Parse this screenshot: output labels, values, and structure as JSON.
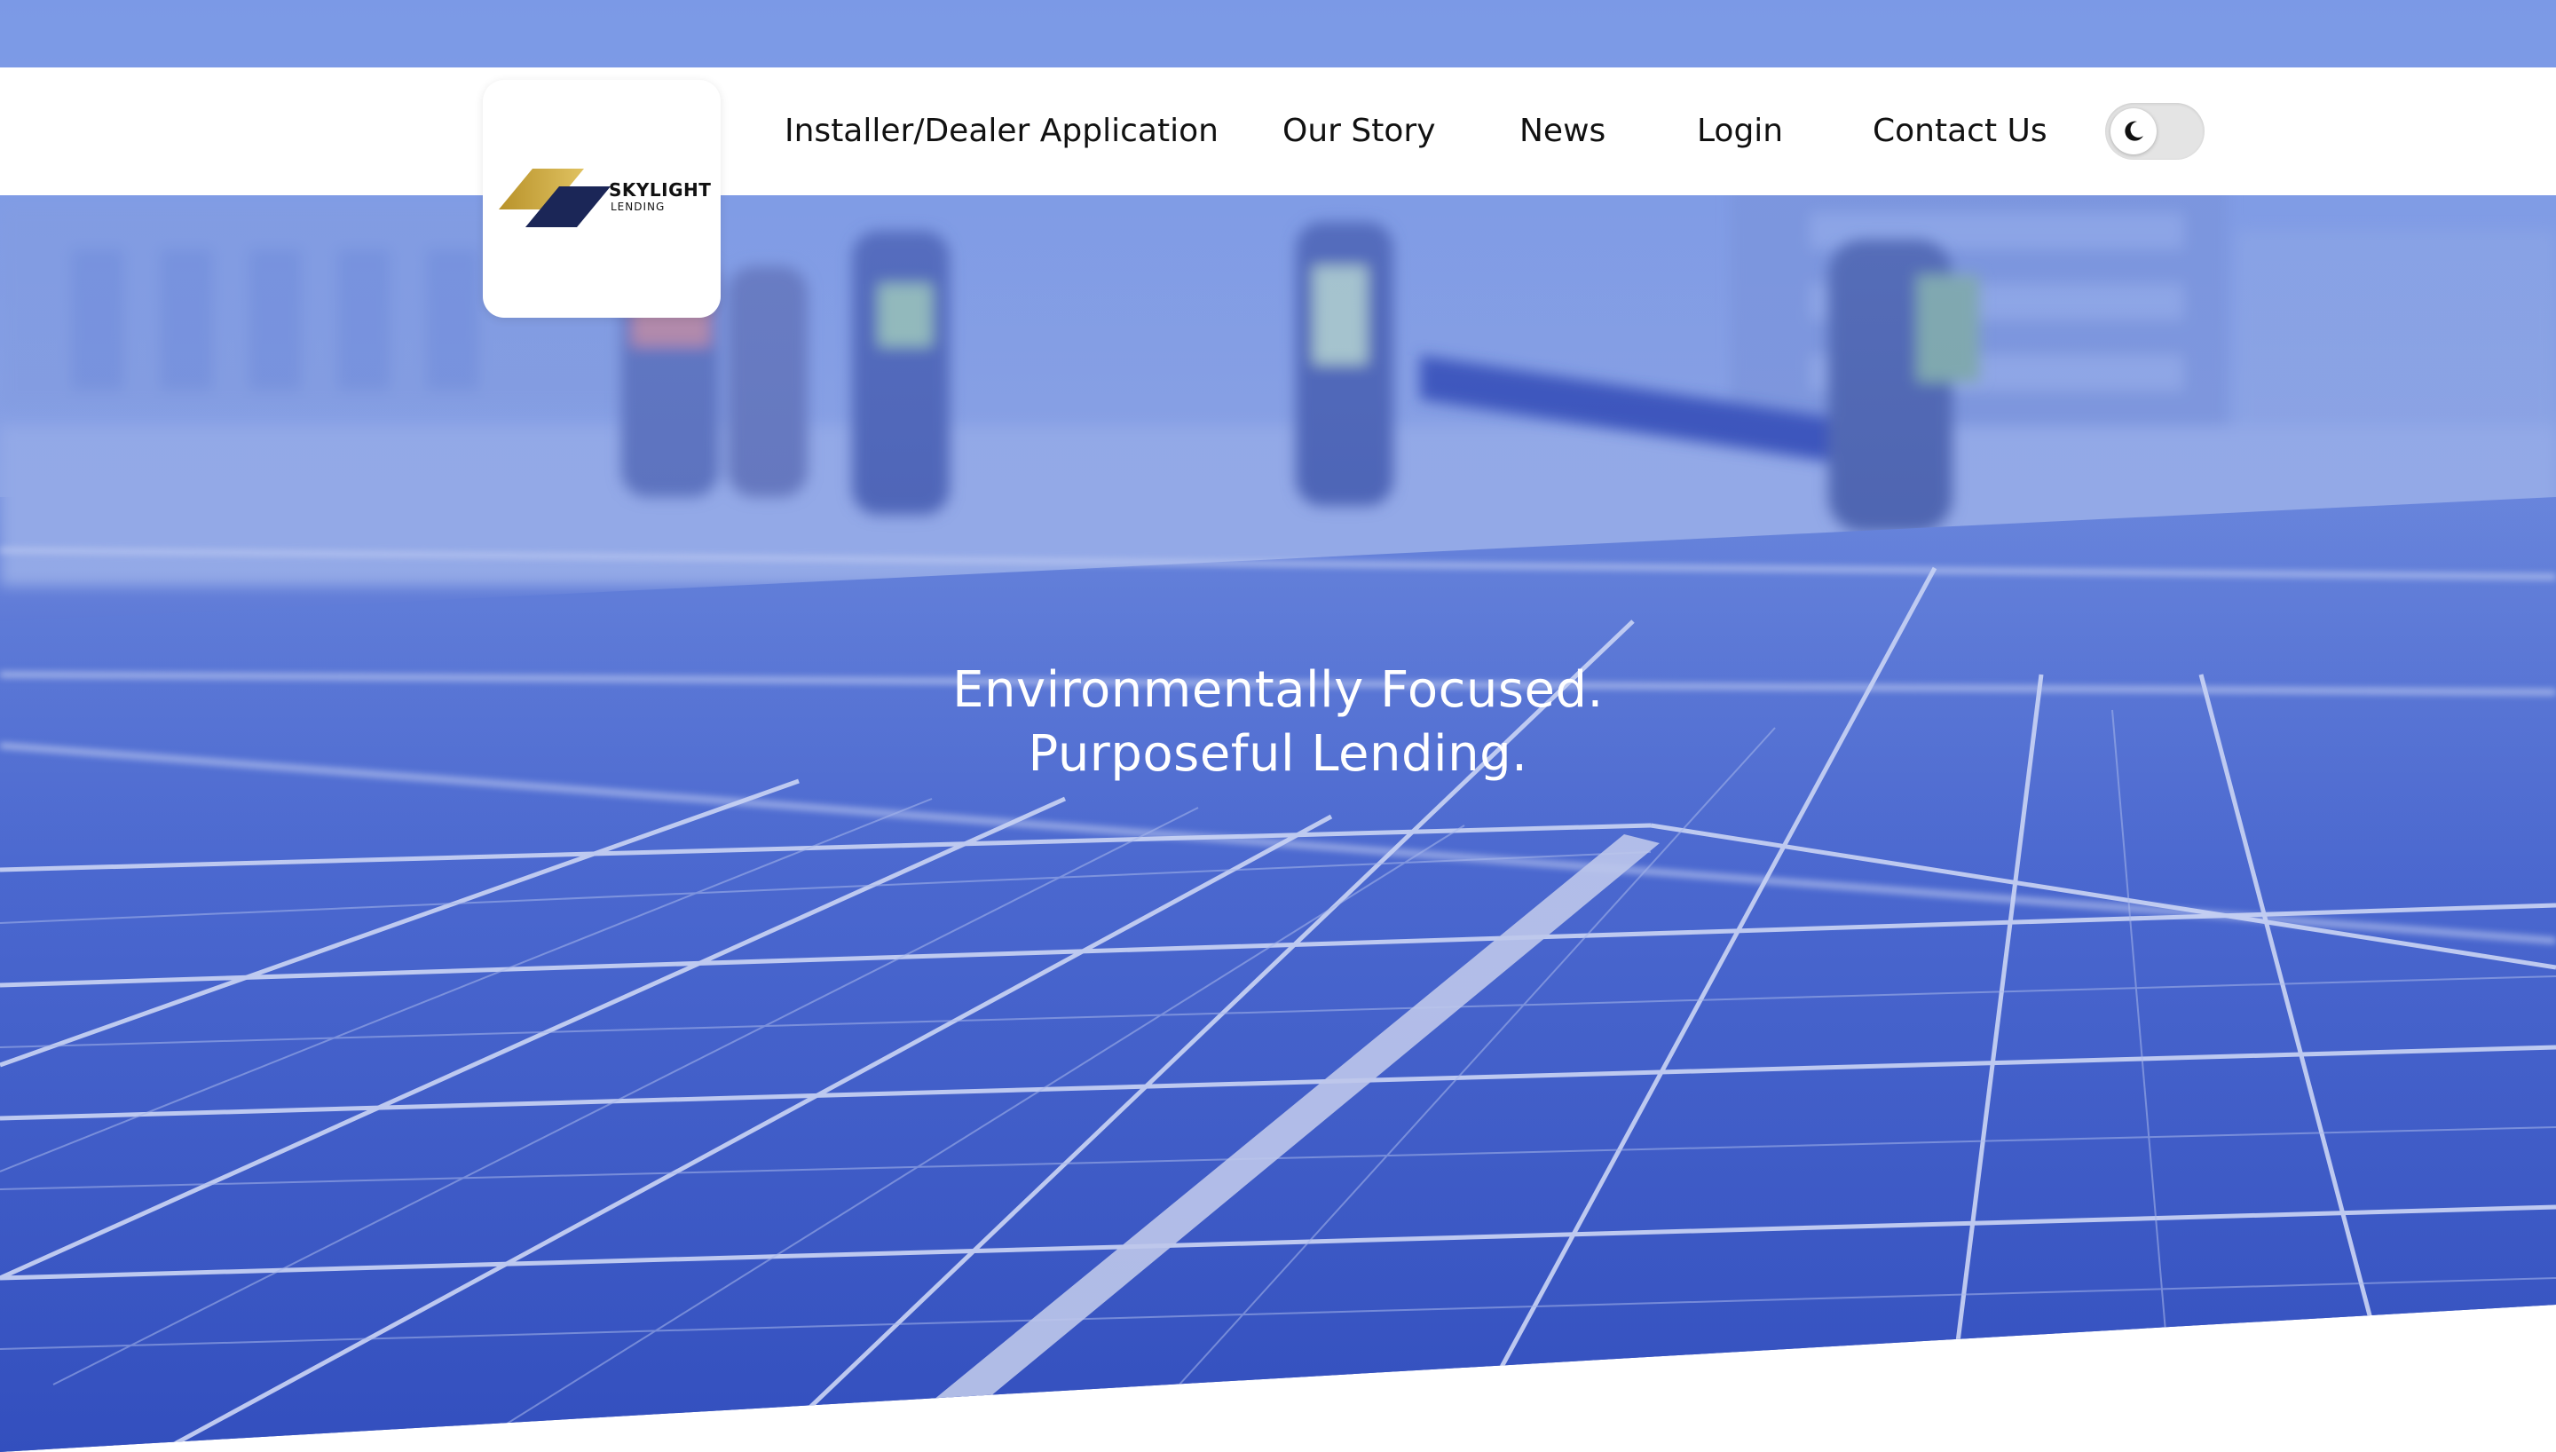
{
  "brand": {
    "name": "SKYLIGHT",
    "sub": "LENDING",
    "colors": {
      "gold": "#c9a227",
      "navy": "#1b2657"
    }
  },
  "nav": {
    "items": [
      {
        "label": "Installer/Dealer Application"
      },
      {
        "label": "Our Story"
      },
      {
        "label": "News"
      },
      {
        "label": "Login"
      },
      {
        "label": "Contact Us"
      }
    ],
    "theme_toggle": {
      "icon": "moon-icon",
      "state": "light"
    }
  },
  "hero": {
    "line1": "Environmentally Focused.",
    "line2": "Purposeful Lending.",
    "background": "solar-panels-workers-photo",
    "tint": "#4f6fd6"
  }
}
